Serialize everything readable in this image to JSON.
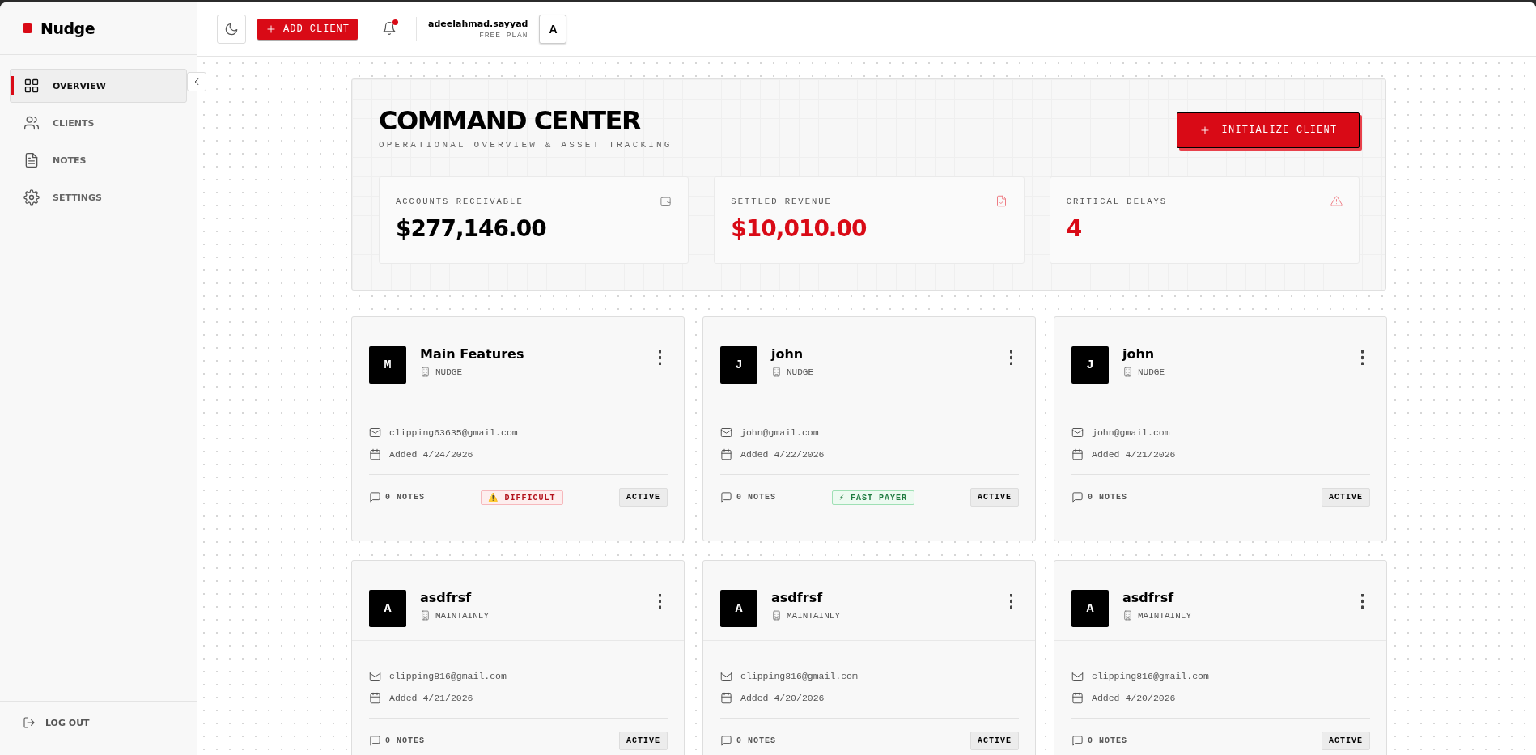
{
  "brand": {
    "name": "Nudge"
  },
  "sidebar": {
    "items": [
      {
        "kind": "grid",
        "label": "OVERVIEW",
        "selected": true
      },
      {
        "kind": "users",
        "label": "CLIENTS",
        "selected": false
      },
      {
        "kind": "file",
        "label": "NOTES",
        "selected": false
      },
      {
        "kind": "gear",
        "label": "SETTINGS",
        "selected": false
      }
    ],
    "logout": "LOG OUT"
  },
  "topbar": {
    "add_button": "ADD CLIENT",
    "notification_unread": true,
    "user": {
      "name": "adeelahmad.sayyad",
      "plan": "FREE PLAN",
      "initial": "A"
    }
  },
  "header": {
    "title": "COMMAND CENTER",
    "subtitle": "OPERATIONAL OVERVIEW & ASSET TRACKING",
    "button": "INITIALIZE CLIENT"
  },
  "stats": [
    {
      "kind": "wallet",
      "label": "ACCOUNTS RECEIVABLE",
      "value": "$277,146.00",
      "color": "#000000"
    },
    {
      "kind": "file",
      "label": "SETTLED REVENUE",
      "value": "$10,010.00",
      "color": "#d90a16"
    },
    {
      "kind": "alert",
      "label": "CRITICAL DELAYS",
      "value": "4",
      "color": "#d90a16"
    }
  ],
  "clients": [
    {
      "initial": "M",
      "name": "Main Features",
      "company": "NUDGE",
      "email": "clipping63635@gmail.com",
      "added": "Added 4/24/2026",
      "notes": "0 NOTES",
      "tag": {
        "kind": "difficult",
        "label": "⚠️ DIFFICULT"
      },
      "status": "ACTIVE"
    },
    {
      "initial": "J",
      "name": "john",
      "company": "NUDGE",
      "email": "john@gmail.com",
      "added": "Added 4/22/2026",
      "notes": "0 NOTES",
      "tag": {
        "kind": "fast",
        "label": "⚡ FAST PAYER"
      },
      "status": "ACTIVE"
    },
    {
      "initial": "J",
      "name": "john",
      "company": "NUDGE",
      "email": "john@gmail.com",
      "added": "Added 4/21/2026",
      "notes": "0 NOTES",
      "status": "ACTIVE"
    },
    {
      "initial": "A",
      "name": "asdfrsf",
      "company": "MAINTAINLY",
      "email": "clipping816@gmail.com",
      "added": "Added 4/21/2026",
      "notes": "0 NOTES",
      "status": "ACTIVE"
    },
    {
      "initial": "A",
      "name": "asdfrsf",
      "company": "MAINTAINLY",
      "email": "clipping816@gmail.com",
      "added": "Added 4/20/2026",
      "notes": "0 NOTES",
      "status": "ACTIVE"
    },
    {
      "initial": "A",
      "name": "asdfrsf",
      "company": "MAINTAINLY",
      "email": "clipping816@gmail.com",
      "added": "Added 4/20/2026",
      "notes": "0 NOTES",
      "status": "ACTIVE"
    }
  ]
}
